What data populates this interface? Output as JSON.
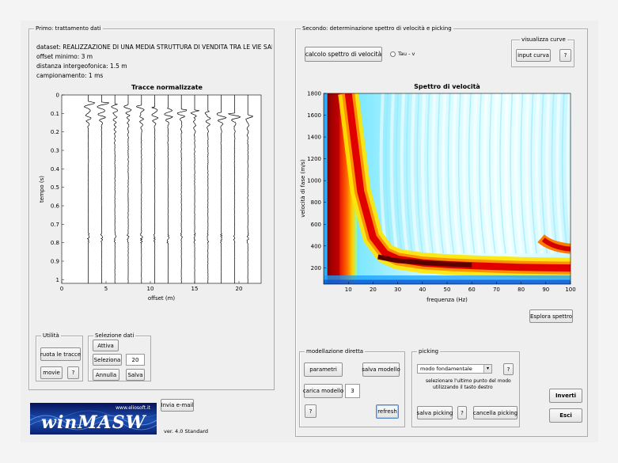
{
  "panel1": {
    "title": "Primo: trattamento dati",
    "info": [
      "dataset:  REALIZZAZIONE DI UNA MEDIA STRUTTURA DI VENDITA TRA LE VIE SAN FERDINANDO",
      "offset minimo: 3 m",
      "distanza intergeofonica: 1.5 m",
      "campionamento: 1 ms"
    ],
    "utility_title": "Utilità",
    "ruota_label": "ruota le tracce",
    "movie_label": "movie",
    "help_label": "?",
    "selezione_title": "Selezione dati",
    "attiva_label": "Attiva",
    "seleziona_label": "Seleziona",
    "seleziona_value": "20",
    "annulla_label": "Annulla",
    "salva_label": "Salva"
  },
  "footer": {
    "email_label": "Invia e-mail",
    "logo_url": "www.eliosoft.it",
    "logo_text": "winMASW",
    "version": "ver. 4.0 Standard"
  },
  "panel2": {
    "title": "Secondo: determinazione spettro di velocità e picking",
    "calcolo_label": "calcolo spettro di velocità",
    "tau_label": "Tau - v",
    "visualizza_title": "visualizza curve",
    "input_curva_label": "input curva",
    "help_label": "?",
    "esplora_label": "Esplora spettro",
    "modellazione_title": "modellazione diretta",
    "parametri_label": "parametri",
    "salva_modello_label": "salva modello",
    "carica_modello_label": "carica modello",
    "modello_value": "3",
    "refresh_label": "refresh",
    "picking_title": "picking",
    "modo_value": "modo fondamentale",
    "picking_hint_1": "selezionare l'ultimo punto del modo",
    "picking_hint_2": "utilizzando il tasto destro",
    "salva_picking_label": "salva picking",
    "cancella_picking_label": "cancella picking",
    "inverti_label": "Inverti",
    "esci_label": "Esci"
  },
  "chart_data": [
    {
      "type": "line",
      "title": "Tracce normalizzate",
      "xlabel": "offset (m)",
      "ylabel": "tempo (s)",
      "xlim": [
        0,
        22.5
      ],
      "ylim": [
        0,
        1.02
      ],
      "y_inverted": true,
      "x_ticks": [
        0,
        5,
        10,
        15,
        20
      ],
      "y_ticks": [
        0,
        0.1,
        0.2,
        0.3,
        0.4,
        0.5,
        0.6,
        0.7,
        0.8,
        0.9,
        1
      ],
      "traces_offset": [
        3,
        4.5,
        6,
        7.5,
        9,
        10.5,
        12,
        13.5,
        15,
        16.5,
        18,
        19.5,
        21
      ],
      "grid": false
    },
    {
      "type": "heatmap",
      "title": "Spettro di velocità",
      "xlabel": "frequenza (Hz)",
      "ylabel": "velocità di fase (m/s)",
      "xlim": [
        0,
        100
      ],
      "ylim": [
        50,
        1800
      ],
      "x_ticks": [
        10,
        20,
        30,
        40,
        50,
        60,
        70,
        80,
        90,
        100
      ],
      "y_ticks": [
        200,
        400,
        600,
        800,
        1000,
        1200,
        1400,
        1600,
        1800
      ],
      "colormap": "jet",
      "fundamental_mode": {
        "frequency": [
          10,
          15,
          20,
          25,
          30,
          40,
          50,
          60,
          70,
          80,
          90
        ],
        "velocity": [
          1800,
          900,
          480,
          330,
          280,
          245,
          230,
          220,
          212,
          205,
          200
        ]
      },
      "grid": false
    }
  ]
}
